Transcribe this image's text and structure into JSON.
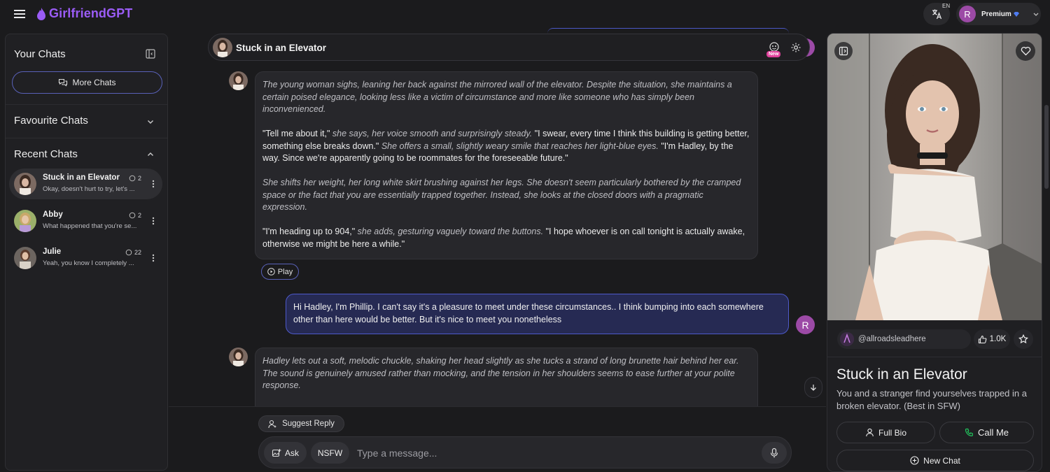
{
  "app": {
    "name": "GirlfriendGPT",
    "brand_color": "#9b5cf6",
    "accent_color": "#5961b8"
  },
  "topbar": {
    "menu_icon": "hamburger-icon",
    "translate_icon": "translate-icon",
    "language_code": "EN",
    "user_initial": "R",
    "plan_label": "Premium",
    "plan_icon": "diamond-icon",
    "dropdown_icon": "chevron-down-icon"
  },
  "sidebar": {
    "title": "Your Chats",
    "more_chats_label": "More Chats",
    "favourite_label": "Favourite Chats",
    "recent_label": "Recent Chats",
    "chats": [
      {
        "name": "Stuck in an Elevator",
        "preview": "Okay, doesn't hurt to try, let's ...",
        "count": "2",
        "active": true
      },
      {
        "name": "Abby",
        "preview": "What happened that you're se...",
        "count": "2",
        "active": false
      },
      {
        "name": "Julie",
        "preview": "Yeah, you know I completely ...",
        "count": "22",
        "active": false
      }
    ]
  },
  "chat": {
    "title": "Stuck in an Elevator",
    "new_badge": "New",
    "messages": {
      "ai1": {
        "p1": "The young woman sighs, leaning her back against the mirrored wall of the elevator. Despite the situation, she maintains a certain poised elegance, looking less like a victim of circumstance and more like someone who has simply been inconvenienced.",
        "p2a": "\"Tell me about it,\"",
        "p2b": " she says, her voice smooth and surprisingly steady. ",
        "p2c": "\"I swear, every time I think this building is getting better, something else breaks down.\"",
        "p2d": " She offers a small, slightly weary smile that reaches her light-blue eyes. ",
        "p2e": "\"I'm Hadley, by the way. Since we're apparently going to be roommates for the foreseeable future.\"",
        "p3": "She shifts her weight, her long white skirt brushing against her legs. She doesn't seem particularly bothered by the cramped space or the fact that you are essentially trapped together. Instead, she looks at the closed doors with a pragmatic expression.",
        "p4a": "\"I'm heading up to 904,\"",
        "p4b": " she adds, gesturing vaguely toward the buttons. ",
        "p4c": "\"I hope whoever is on call tonight is actually awake, otherwise we might be here a while.\""
      },
      "play_label": "Play",
      "user1": "Hi Hadley, I'm Phillip. I can't say it's a pleasure to meet under these circumstances.. I think bumping into each somewhere other than here would be better. But it's nice to meet you nonetheless",
      "ai2": "Hadley lets out a soft, melodic chuckle, shaking her head slightly as she tucks a strand of long brunette hair behind her ear. The sound is genuinely amused rather than mocking, and the tension in her shoulders seems to ease further at your polite response."
    },
    "suggest_label": "Suggest Reply",
    "ask_label": "Ask",
    "nsfw_label": "NSFW",
    "input_placeholder": "Type a message..."
  },
  "panel": {
    "creator": "@allroadsleadhere",
    "likes": "1.0K",
    "title": "Stuck in an Elevator",
    "description": "You and a stranger find yourselves trapped in a broken elevator. (Best in SFW)",
    "full_bio_label": "Full Bio",
    "call_label": "Call Me",
    "new_chat_label": "New Chat",
    "call_color": "#22c55e"
  }
}
